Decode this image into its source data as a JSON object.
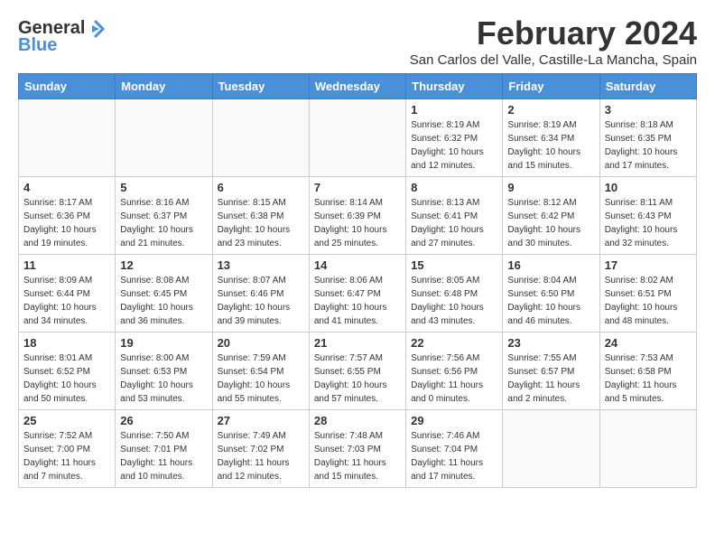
{
  "logo": {
    "general": "General",
    "blue": "Blue"
  },
  "title": "February 2024",
  "subtitle": "San Carlos del Valle, Castille-La Mancha, Spain",
  "headers": [
    "Sunday",
    "Monday",
    "Tuesday",
    "Wednesday",
    "Thursday",
    "Friday",
    "Saturday"
  ],
  "weeks": [
    [
      {
        "day": "",
        "info": ""
      },
      {
        "day": "",
        "info": ""
      },
      {
        "day": "",
        "info": ""
      },
      {
        "day": "",
        "info": ""
      },
      {
        "day": "1",
        "info": "Sunrise: 8:19 AM\nSunset: 6:32 PM\nDaylight: 10 hours\nand 12 minutes."
      },
      {
        "day": "2",
        "info": "Sunrise: 8:19 AM\nSunset: 6:34 PM\nDaylight: 10 hours\nand 15 minutes."
      },
      {
        "day": "3",
        "info": "Sunrise: 8:18 AM\nSunset: 6:35 PM\nDaylight: 10 hours\nand 17 minutes."
      }
    ],
    [
      {
        "day": "4",
        "info": "Sunrise: 8:17 AM\nSunset: 6:36 PM\nDaylight: 10 hours\nand 19 minutes."
      },
      {
        "day": "5",
        "info": "Sunrise: 8:16 AM\nSunset: 6:37 PM\nDaylight: 10 hours\nand 21 minutes."
      },
      {
        "day": "6",
        "info": "Sunrise: 8:15 AM\nSunset: 6:38 PM\nDaylight: 10 hours\nand 23 minutes."
      },
      {
        "day": "7",
        "info": "Sunrise: 8:14 AM\nSunset: 6:39 PM\nDaylight: 10 hours\nand 25 minutes."
      },
      {
        "day": "8",
        "info": "Sunrise: 8:13 AM\nSunset: 6:41 PM\nDaylight: 10 hours\nand 27 minutes."
      },
      {
        "day": "9",
        "info": "Sunrise: 8:12 AM\nSunset: 6:42 PM\nDaylight: 10 hours\nand 30 minutes."
      },
      {
        "day": "10",
        "info": "Sunrise: 8:11 AM\nSunset: 6:43 PM\nDaylight: 10 hours\nand 32 minutes."
      }
    ],
    [
      {
        "day": "11",
        "info": "Sunrise: 8:09 AM\nSunset: 6:44 PM\nDaylight: 10 hours\nand 34 minutes."
      },
      {
        "day": "12",
        "info": "Sunrise: 8:08 AM\nSunset: 6:45 PM\nDaylight: 10 hours\nand 36 minutes."
      },
      {
        "day": "13",
        "info": "Sunrise: 8:07 AM\nSunset: 6:46 PM\nDaylight: 10 hours\nand 39 minutes."
      },
      {
        "day": "14",
        "info": "Sunrise: 8:06 AM\nSunset: 6:47 PM\nDaylight: 10 hours\nand 41 minutes."
      },
      {
        "day": "15",
        "info": "Sunrise: 8:05 AM\nSunset: 6:48 PM\nDaylight: 10 hours\nand 43 minutes."
      },
      {
        "day": "16",
        "info": "Sunrise: 8:04 AM\nSunset: 6:50 PM\nDaylight: 10 hours\nand 46 minutes."
      },
      {
        "day": "17",
        "info": "Sunrise: 8:02 AM\nSunset: 6:51 PM\nDaylight: 10 hours\nand 48 minutes."
      }
    ],
    [
      {
        "day": "18",
        "info": "Sunrise: 8:01 AM\nSunset: 6:52 PM\nDaylight: 10 hours\nand 50 minutes."
      },
      {
        "day": "19",
        "info": "Sunrise: 8:00 AM\nSunset: 6:53 PM\nDaylight: 10 hours\nand 53 minutes."
      },
      {
        "day": "20",
        "info": "Sunrise: 7:59 AM\nSunset: 6:54 PM\nDaylight: 10 hours\nand 55 minutes."
      },
      {
        "day": "21",
        "info": "Sunrise: 7:57 AM\nSunset: 6:55 PM\nDaylight: 10 hours\nand 57 minutes."
      },
      {
        "day": "22",
        "info": "Sunrise: 7:56 AM\nSunset: 6:56 PM\nDaylight: 11 hours\nand 0 minutes."
      },
      {
        "day": "23",
        "info": "Sunrise: 7:55 AM\nSunset: 6:57 PM\nDaylight: 11 hours\nand 2 minutes."
      },
      {
        "day": "24",
        "info": "Sunrise: 7:53 AM\nSunset: 6:58 PM\nDaylight: 11 hours\nand 5 minutes."
      }
    ],
    [
      {
        "day": "25",
        "info": "Sunrise: 7:52 AM\nSunset: 7:00 PM\nDaylight: 11 hours\nand 7 minutes."
      },
      {
        "day": "26",
        "info": "Sunrise: 7:50 AM\nSunset: 7:01 PM\nDaylight: 11 hours\nand 10 minutes."
      },
      {
        "day": "27",
        "info": "Sunrise: 7:49 AM\nSunset: 7:02 PM\nDaylight: 11 hours\nand 12 minutes."
      },
      {
        "day": "28",
        "info": "Sunrise: 7:48 AM\nSunset: 7:03 PM\nDaylight: 11 hours\nand 15 minutes."
      },
      {
        "day": "29",
        "info": "Sunrise: 7:46 AM\nSunset: 7:04 PM\nDaylight: 11 hours\nand 17 minutes."
      },
      {
        "day": "",
        "info": ""
      },
      {
        "day": "",
        "info": ""
      }
    ]
  ]
}
